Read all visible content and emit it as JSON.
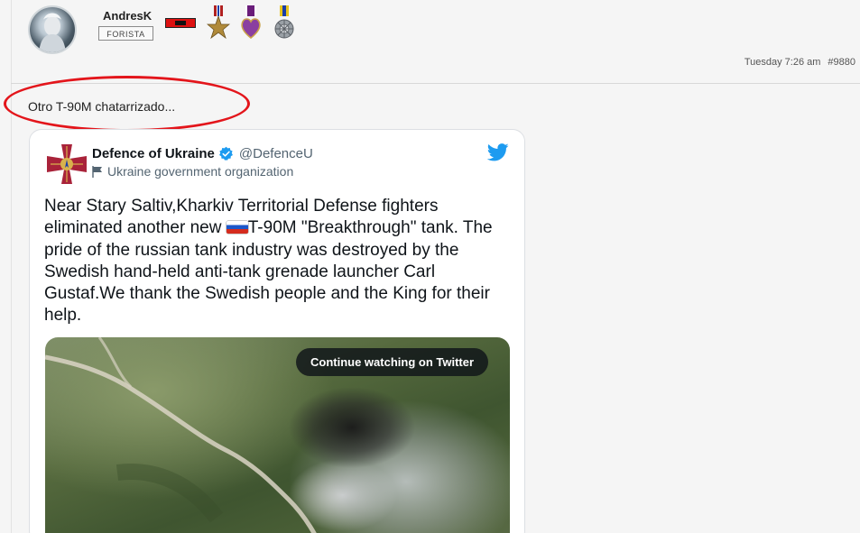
{
  "post": {
    "username": "AndresK",
    "user_title": "FORISTA",
    "timestamp": "Tuesday 7:26 am",
    "post_number": "#9880",
    "text": "Otro T-90M chatarrizado..."
  },
  "tweet": {
    "author_name": "Defence of Ukraine",
    "handle": "@DefenceU",
    "org_label": "Ukraine government organization",
    "body_part1": "Near Stary Saltiv,Kharkiv Territorial Defense fighters eliminated another new ",
    "body_part2": "T-90M \"Breakthrough\" tank. The pride of the russian tank industry was destroyed by the Swedish hand-held anti-tank grenade launcher Carl Gustaf.We thank the Swedish people and the King for their help.",
    "video_button": "Continue watching on Twitter"
  },
  "colors": {
    "highlight_ring": "#e3151b",
    "twitter_blue": "#1d9bf0",
    "verified_blue": "#1d9bf0"
  },
  "icons": {
    "avatar": "user-avatar",
    "medals": [
      "flag-badge",
      "bronze-star-medal",
      "purple-heart-medal",
      "service-cross-medal"
    ],
    "tweet_logo": "twitter-bird-icon",
    "verified": "verified-badge-icon",
    "org": "flag-icon"
  }
}
